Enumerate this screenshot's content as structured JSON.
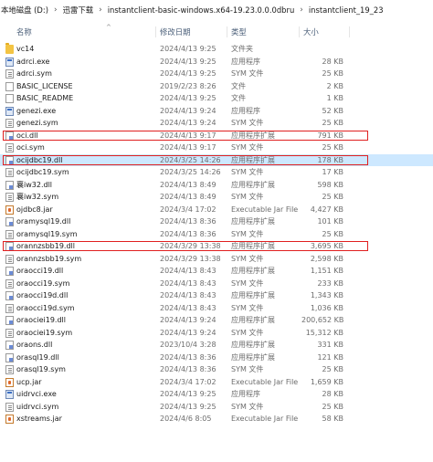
{
  "breadcrumb": [
    "本地磁盘 (D:)",
    "迅雷下载",
    "instantclient-basic-windows.x64-19.23.0.0.0dbru",
    "instantclient_19_23"
  ],
  "columns": {
    "name": "名称",
    "date": "修改日期",
    "type": "类型",
    "size": "大小"
  },
  "files": [
    {
      "name": "vc14",
      "date": "2024/4/13 9:25",
      "type": "文件夹",
      "size": "",
      "icon": "folder-icon"
    },
    {
      "name": "adrci.exe",
      "date": "2024/4/13 9:25",
      "type": "应用程序",
      "size": "28 KB",
      "icon": "exe-icon"
    },
    {
      "name": "adrci.sym",
      "date": "2024/4/13 9:25",
      "type": "SYM 文件",
      "size": "25 KB",
      "icon": "sym-icon"
    },
    {
      "name": "BASIC_LICENSE",
      "date": "2019/2/23 8:26",
      "type": "文件",
      "size": "2 KB",
      "icon": "file-icon"
    },
    {
      "name": "BASIC_README",
      "date": "2024/4/13 9:25",
      "type": "文件",
      "size": "1 KB",
      "icon": "file-icon"
    },
    {
      "name": "genezi.exe",
      "date": "2024/4/13 9:24",
      "type": "应用程序",
      "size": "52 KB",
      "icon": "exe-icon"
    },
    {
      "name": "genezi.sym",
      "date": "2024/4/13 9:24",
      "type": "SYM 文件",
      "size": "25 KB",
      "icon": "sym-icon"
    },
    {
      "name": "oci.dll",
      "date": "2024/4/13 9:17",
      "type": "应用程序扩展",
      "size": "791 KB",
      "icon": "dll-icon"
    },
    {
      "name": "oci.sym",
      "date": "2024/4/13 9:17",
      "type": "SYM 文件",
      "size": "25 KB",
      "icon": "sym-icon"
    },
    {
      "name": "ocijdbc19.dll",
      "date": "2024/3/25 14:26",
      "type": "应用程序扩展",
      "size": "178 KB",
      "icon": "dll-icon"
    },
    {
      "name": "ocijdbc19.sym",
      "date": "2024/3/25 14:26",
      "type": "SYM 文件",
      "size": "17 KB",
      "icon": "sym-icon"
    },
    {
      "name": "襄iw32.dll",
      "date": "2024/4/13 8:49",
      "type": "应用程序扩展",
      "size": "598 KB",
      "icon": "dll-icon"
    },
    {
      "name": "襄iw32.sym",
      "date": "2024/4/13 8:49",
      "type": "SYM 文件",
      "size": "25 KB",
      "icon": "sym-icon"
    },
    {
      "name": "ojdbc8.jar",
      "date": "2024/3/4 17:02",
      "type": "Executable Jar File",
      "size": "4,427 KB",
      "icon": "jar-icon"
    },
    {
      "name": "oramysql19.dll",
      "date": "2024/4/13 8:36",
      "type": "应用程序扩展",
      "size": "101 KB",
      "icon": "dll-icon"
    },
    {
      "name": "oramysql19.sym",
      "date": "2024/4/13 8:36",
      "type": "SYM 文件",
      "size": "25 KB",
      "icon": "sym-icon"
    },
    {
      "name": "orannzsbb19.dll",
      "date": "2024/3/29 13:38",
      "type": "应用程序扩展",
      "size": "3,695 KB",
      "icon": "dll-icon"
    },
    {
      "name": "orannzsbb19.sym",
      "date": "2024/3/29 13:38",
      "type": "SYM 文件",
      "size": "2,598 KB",
      "icon": "sym-icon"
    },
    {
      "name": "oraocci19.dll",
      "date": "2024/4/13 8:43",
      "type": "应用程序扩展",
      "size": "1,151 KB",
      "icon": "dll-icon"
    },
    {
      "name": "oraocci19.sym",
      "date": "2024/4/13 8:43",
      "type": "SYM 文件",
      "size": "233 KB",
      "icon": "sym-icon"
    },
    {
      "name": "oraocci19d.dll",
      "date": "2024/4/13 8:43",
      "type": "应用程序扩展",
      "size": "1,343 KB",
      "icon": "dll-icon"
    },
    {
      "name": "oraocci19d.sym",
      "date": "2024/4/13 8:43",
      "type": "SYM 文件",
      "size": "1,036 KB",
      "icon": "sym-icon"
    },
    {
      "name": "oraociei19.dll",
      "date": "2024/4/13 9:24",
      "type": "应用程序扩展",
      "size": "200,652 KB",
      "icon": "dll-icon"
    },
    {
      "name": "oraociei19.sym",
      "date": "2024/4/13 9:24",
      "type": "SYM 文件",
      "size": "15,312 KB",
      "icon": "sym-icon"
    },
    {
      "name": "oraons.dll",
      "date": "2023/10/4 3:28",
      "type": "应用程序扩展",
      "size": "331 KB",
      "icon": "dll-icon"
    },
    {
      "name": "orasql19.dll",
      "date": "2024/4/13 8:36",
      "type": "应用程序扩展",
      "size": "121 KB",
      "icon": "dll-icon"
    },
    {
      "name": "orasql19.sym",
      "date": "2024/4/13 8:36",
      "type": "SYM 文件",
      "size": "25 KB",
      "icon": "sym-icon"
    },
    {
      "name": "ucp.jar",
      "date": "2024/3/4 17:02",
      "type": "Executable Jar File",
      "size": "1,659 KB",
      "icon": "jar-icon"
    },
    {
      "name": "uidrvci.exe",
      "date": "2024/4/13 9:25",
      "type": "应用程序",
      "size": "28 KB",
      "icon": "exe-icon"
    },
    {
      "name": "uidrvci.sym",
      "date": "2024/4/13 9:25",
      "type": "SYM 文件",
      "size": "25 KB",
      "icon": "sym-icon"
    },
    {
      "name": "xstreams.jar",
      "date": "2024/4/6 8:05",
      "type": "Executable Jar File",
      "size": "58 KB",
      "icon": "jar-icon"
    }
  ],
  "selected_index": 9,
  "highlighted_indices": [
    7,
    9,
    16
  ],
  "colors": {
    "highlight": "#e02020",
    "selection": "#cde8ff",
    "header": "#4c607a"
  }
}
